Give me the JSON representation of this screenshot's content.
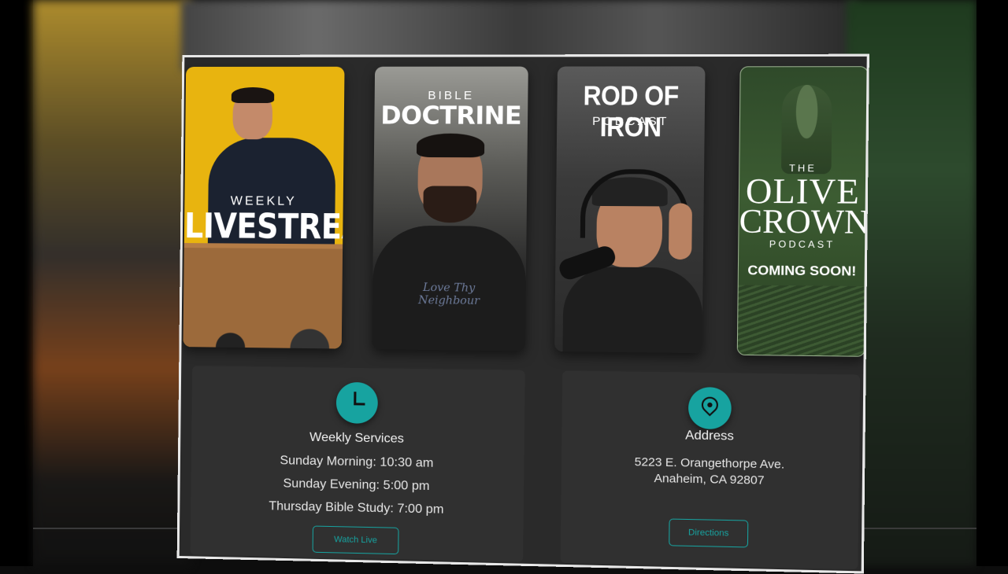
{
  "tiles": [
    {
      "small": "WEEKLY",
      "big": "LIVESTREAM"
    },
    {
      "small": "BIBLE",
      "big": "DOCTRINE",
      "shirt_print": "Love Thy Neighbour"
    },
    {
      "big": "ROD OF IRON",
      "small": "PODCAST"
    },
    {
      "the": "THE",
      "big_line1": "OLIVE",
      "big_line2": "CROWN",
      "small": "PODCAST",
      "status": "COMING SOON!"
    }
  ],
  "services": {
    "title": "Weekly Services",
    "lines": [
      "Sunday Morning: 10:30 am",
      "Sunday Evening: 5:00 pm",
      "Thursday Bible Study: 7:00 pm"
    ],
    "button": "Watch Live"
  },
  "address": {
    "title": "Address",
    "line1": "5223 E. Orangethorpe Ave.",
    "line2": "Anaheim, CA 92807",
    "button": "Directions"
  },
  "colors": {
    "accent": "#17a3a0",
    "livestream_bg": "#e8b40f",
    "olive_bg": "#3c5c32"
  },
  "icons": {
    "services": "clock-icon",
    "address": "map-pin-icon"
  }
}
